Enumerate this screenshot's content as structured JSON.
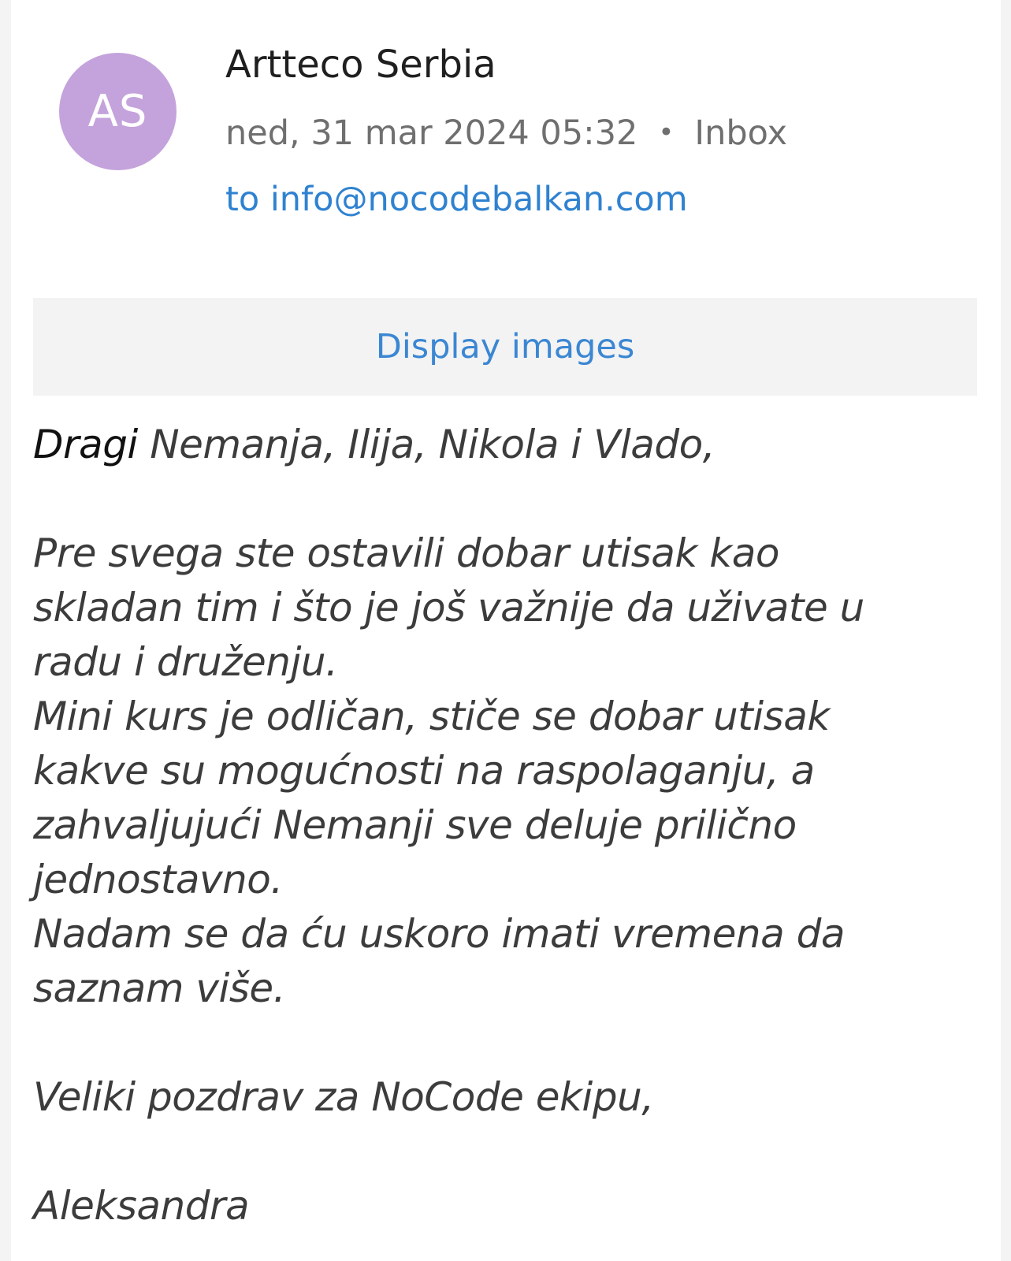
{
  "sender": {
    "avatar_initials": "AS",
    "avatar_color": "#c4a3dc",
    "name": "Artteco Serbia",
    "date": "ned, 31 mar 2024 05:32",
    "separator": "•",
    "folder": "Inbox",
    "recipient": "to info@nocodebalkan.com"
  },
  "images_banner": {
    "label": "Display images"
  },
  "message": {
    "greeting_word": "Dragi",
    "greeting_names": "Nemanja, Ilija, Nikola i Vlado,",
    "paragraph_1_line_1": "Pre svega ste ostavili dobar utisak kao",
    "paragraph_1_line_2": "skladan tim i što je još važnije da uživate u",
    "paragraph_1_line_3": "radu i druženju.",
    "paragraph_2_line_1": "Mini kurs je odličan, stiče se dobar utisak",
    "paragraph_2_line_2": "kakve su mogućnosti na raspolaganju, a",
    "paragraph_2_line_3": "zahvaljujući Nemanji sve deluje prilično",
    "paragraph_2_line_4": "jednostavno.",
    "paragraph_3_line_1": "Nadam se da ću uskoro imati vremena da",
    "paragraph_3_line_2": "saznam više.",
    "closing": "Veliki pozdrav za NoCode ekipu,",
    "signature": "Aleksandra"
  }
}
